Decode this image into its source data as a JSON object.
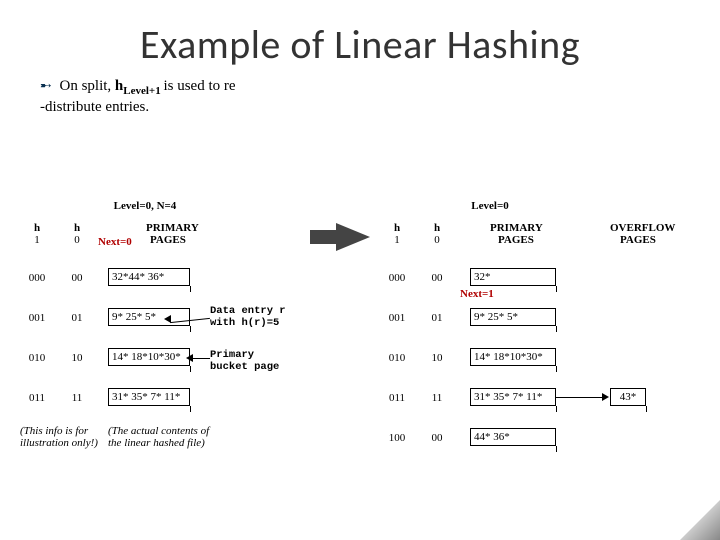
{
  "title": "Example of Linear Hashing",
  "subtitle": {
    "prefix": "On split, ",
    "func": "h",
    "sub": "Level+1 ",
    "mid": "is used to re",
    "line2": "-distribute entries."
  },
  "left": {
    "caption": "Level=0, N=4",
    "h1": "h",
    "h1sub": "1",
    "h0": "h",
    "h0sub": "0",
    "phead": "PRIMARY",
    "phead2": "PAGES",
    "next": "Next=0",
    "rows": [
      {
        "h1": "000",
        "h0": "00",
        "pg": "32*44* 36*"
      },
      {
        "h1": "001",
        "h0": "01",
        "pg": "9* 25* 5*"
      },
      {
        "h1": "010",
        "h0": "10",
        "pg": "14* 18*10*30*"
      },
      {
        "h1": "011",
        "h0": "11",
        "pg": "31* 35* 7* 11*"
      }
    ],
    "annot1a": "Data entry r",
    "annot1b": "with h(r)=5",
    "annot2a": "Primary",
    "annot2b": "bucket page",
    "foot1": "(This info is for illustration only!)",
    "foot2": "(The actual contents of the linear hashed file)"
  },
  "right": {
    "caption": "Level=0",
    "h1": "h",
    "h1sub": "1",
    "h0": "h",
    "h0sub": "0",
    "phead": "PRIMARY",
    "phead2": "PAGES",
    "ohead": "OVERFLOW",
    "ohead2": "PAGES",
    "next": "Next=1",
    "rows": [
      {
        "h1": "000",
        "h0": "00",
        "pg": "32*"
      },
      {
        "h1": "001",
        "h0": "01",
        "pg": "9* 25* 5*"
      },
      {
        "h1": "010",
        "h0": "10",
        "pg": "14* 18*10*30*"
      },
      {
        "h1": "011",
        "h0": "11",
        "pg": "31* 35* 7* 11*"
      },
      {
        "h1": "100",
        "h0": "00",
        "pg": "44* 36*"
      }
    ],
    "ov": "43*"
  }
}
